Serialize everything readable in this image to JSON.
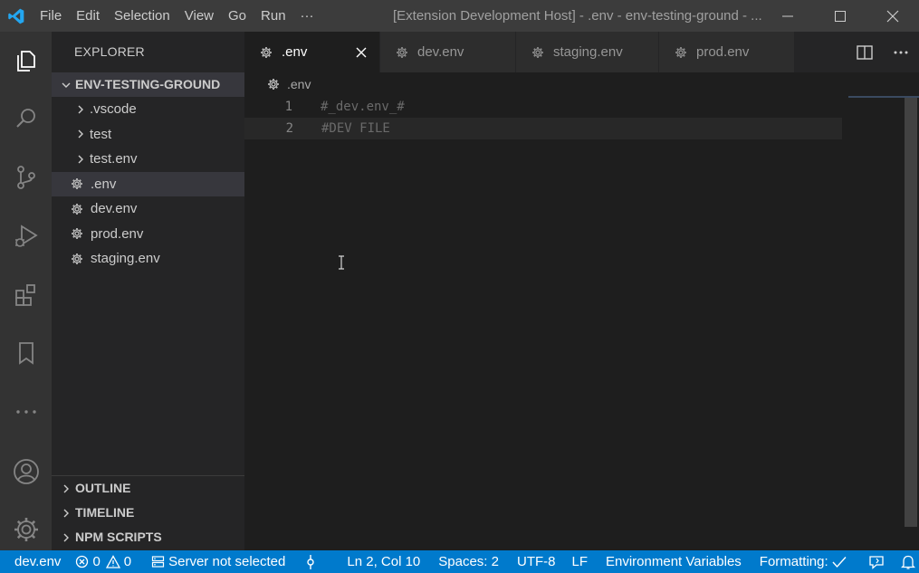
{
  "titlebar": {
    "menu": [
      "File",
      "Edit",
      "Selection",
      "View",
      "Go",
      "Run",
      "···"
    ],
    "title": "[Extension Development Host] - .env - env-testing-ground - ..."
  },
  "activity": {
    "icons": [
      "explorer-icon",
      "search-icon",
      "source-control-icon",
      "run-debug-icon",
      "extensions-icon",
      "bookmark-icon",
      "more-icon",
      "account-icon",
      "manage-gear-icon"
    ]
  },
  "sidebar": {
    "title": "EXPLORER",
    "folder": "ENV-TESTING-GROUND",
    "items": [
      {
        "label": ".vscode",
        "type": "folder"
      },
      {
        "label": "test",
        "type": "folder"
      },
      {
        "label": "test.env",
        "type": "folder"
      },
      {
        "label": ".env",
        "type": "file"
      },
      {
        "label": "dev.env",
        "type": "file"
      },
      {
        "label": "prod.env",
        "type": "file"
      },
      {
        "label": "staging.env",
        "type": "file"
      }
    ],
    "sections": [
      "OUTLINE",
      "TIMELINE",
      "NPM SCRIPTS"
    ]
  },
  "tabs": [
    {
      "label": ".env",
      "active": true
    },
    {
      "label": "dev.env",
      "active": false
    },
    {
      "label": "staging.env",
      "active": false
    },
    {
      "label": "prod.env",
      "active": false
    }
  ],
  "breadcrumb": ".env",
  "editor": {
    "lines": [
      {
        "number": "1",
        "text": "#_dev.env_#"
      },
      {
        "number": "2",
        "text": "#DEV FILE"
      }
    ]
  },
  "statusbar": {
    "branch": "dev.env",
    "errors": "0",
    "warnings": "0",
    "server": "Server not selected",
    "position": "Ln 2, Col 10",
    "spaces": "Spaces: 2",
    "encoding": "UTF-8",
    "eol": "LF",
    "language": "Environment Variables",
    "formatting": "Formatting:"
  },
  "colors": {
    "accent": "#007acc",
    "titlebar": "#3c3c3c",
    "activitybar": "#333333",
    "sidebar": "#252526",
    "editor": "#1e1e1e"
  }
}
